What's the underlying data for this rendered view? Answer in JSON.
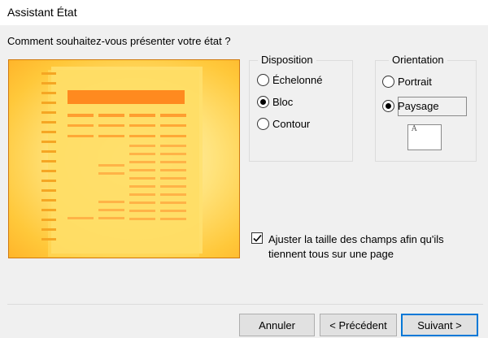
{
  "window": {
    "title": "Assistant État"
  },
  "question": "Comment souhaitez-vous présenter votre état ?",
  "layout_group": {
    "title": "Disposition",
    "options": [
      {
        "label": "Échelonné",
        "selected": false
      },
      {
        "label": "Bloc",
        "selected": true
      },
      {
        "label": "Contour",
        "selected": false
      }
    ]
  },
  "orientation_group": {
    "title": "Orientation",
    "options": [
      {
        "label": "Portrait",
        "selected": false
      },
      {
        "label": "Paysage",
        "selected": true
      }
    ],
    "icon_letter": "A"
  },
  "fit_option": {
    "label": "Ajuster la taille des champs afin qu'ils tiennent tous sur une page",
    "checked": true
  },
  "buttons": {
    "cancel": "Annuler",
    "previous": "< Précédent",
    "next": "Suivant >"
  },
  "colors": {
    "accent": "#0078d7",
    "preview_orange": "#ff7f1e",
    "preview_yellow": "#ffd54a"
  }
}
